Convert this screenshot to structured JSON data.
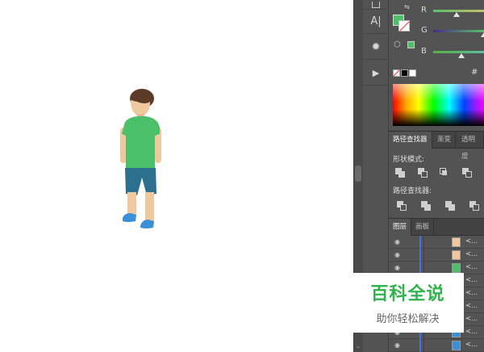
{
  "tools": {
    "items": [
      {
        "name": "type-icon",
        "glyph": "A|"
      },
      {
        "name": "sun-icon",
        "glyph": "✹"
      },
      {
        "name": "play-icon",
        "glyph": "▶"
      }
    ]
  },
  "color": {
    "channels": [
      {
        "label": "R",
        "value": 0.6
      },
      {
        "label": "G",
        "value": 1.0
      },
      {
        "label": "B",
        "value": 0.55
      }
    ],
    "fill_color": "#4cbf6a",
    "hex_label": "#"
  },
  "pathfinder": {
    "tabs": [
      {
        "label": "路径查找器",
        "active": true
      },
      {
        "label": "渐变",
        "active": false
      },
      {
        "label": "透明度",
        "active": false
      }
    ],
    "shape_modes_label": "形状模式:",
    "pathfinders_label": "路径查找器:"
  },
  "layers": {
    "tabs": [
      {
        "label": "图层",
        "active": true
      },
      {
        "label": "画板",
        "active": false
      }
    ],
    "rows": [
      {
        "text": "<...",
        "thumb": "#f0c8a0"
      },
      {
        "text": "<...",
        "thumb": "#f0c8a0"
      },
      {
        "text": "<...",
        "thumb": "#4cbf6a"
      },
      {
        "text": "<...",
        "thumb": "#2d6f8f"
      },
      {
        "text": "<...",
        "thumb": "#f0c8a0"
      },
      {
        "text": "<...",
        "thumb": "#2d6f8f"
      },
      {
        "text": "<...",
        "thumb": "#5b3a29"
      },
      {
        "text": "<...",
        "thumb": "#3a8fd6"
      },
      {
        "text": "<...",
        "thumb": "#3a8fd6"
      }
    ]
  },
  "watermark": {
    "title": "百科全说",
    "subtitle": "助你轻松解决"
  },
  "colors": {
    "shirt": "#4cbf6a",
    "skin": "#f0c8a0",
    "shorts": "#2d6f8f",
    "hair": "#5b3a29",
    "shoes": "#3a8fd6"
  }
}
